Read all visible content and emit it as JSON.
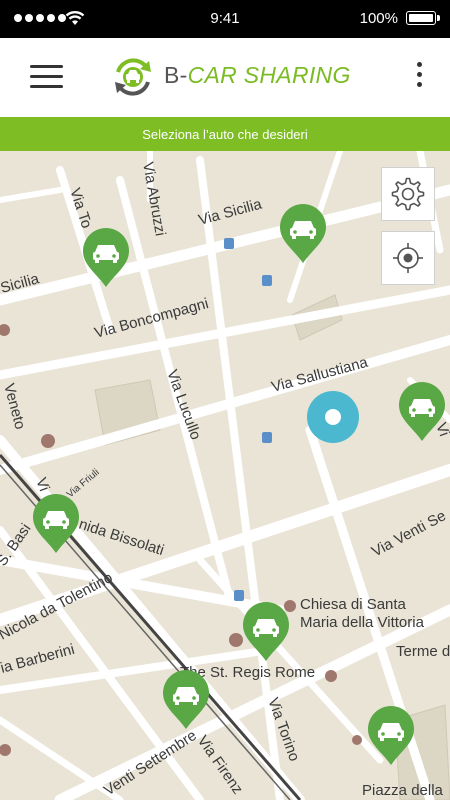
{
  "status_bar": {
    "time": "9:41",
    "battery_text": "100%",
    "battery_level": 1.0,
    "signal_bars": 5
  },
  "header": {
    "brand_prefix": "B-",
    "brand_name": "CAR SHARING",
    "menu_icon": "hamburger-menu-icon",
    "more_icon": "more-vertical-icon",
    "logo_icon": "car-refresh-logo-icon"
  },
  "banner": {
    "text": "Seleziona l’auto che desideri"
  },
  "colors": {
    "brand_green": "#7fbd24",
    "pin_green": "#5aa745",
    "user_location": "#4bb8cf",
    "map_background": "#e9e4d6",
    "road": "#ffffff"
  },
  "map": {
    "street_labels": {
      "via_sicilia": "Via Sicilia",
      "sicilia": "Sicilia",
      "via_to": "Via To",
      "via_abruzzi": "Via Abruzzi",
      "via_boncompagni": "Via Boncompagni",
      "via_sallustiana": "Via Sallustiana",
      "via_lucullo": "Via Lucullo",
      "veneto": "Veneto",
      "via_friuli": "Via Friuli",
      "via_bissolati": "nida Bissolati",
      "via_a": "Vi",
      "s_basi": "S. Basi",
      "nicola_da_tolentino": "Nicola da Tolentino",
      "via_barberini": "ia Barberini",
      "via_venti_settembre_right": "Via Venti Se",
      "via_venti_settembre_bottom": "Venti Settembre",
      "via_torino": "Via Torino",
      "via_firenze": "Via Firenz",
      "viale": "Vi"
    },
    "poi_labels": {
      "chiesa_line1": "Chiesa di Santa",
      "chiesa_line2": "Maria della Vittoria",
      "st_regis": "The St. Regis Rome",
      "terme": "Terme d",
      "piazza": "Piazza della"
    },
    "car_pins": [
      {
        "id": "car-1"
      },
      {
        "id": "car-2"
      },
      {
        "id": "car-3"
      },
      {
        "id": "car-4"
      },
      {
        "id": "car-5"
      },
      {
        "id": "car-6"
      },
      {
        "id": "car-7"
      }
    ],
    "controls": {
      "settings_icon": "gear-icon",
      "locate_icon": "crosshair-icon"
    }
  }
}
